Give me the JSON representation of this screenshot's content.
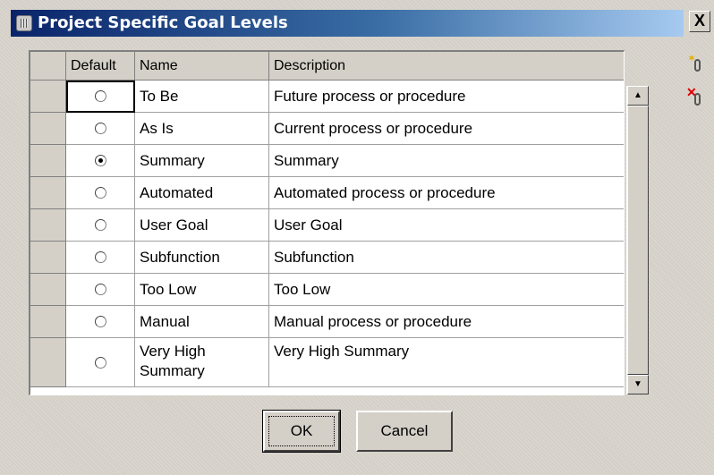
{
  "window": {
    "title": "Project Specific Goal Levels",
    "close_label": "X"
  },
  "toolbar": {
    "add_icon": "add-attachment-icon",
    "remove_icon": "remove-attachment-icon"
  },
  "table": {
    "columns": [
      "Default",
      "Name",
      "Description"
    ],
    "rows": [
      {
        "default": false,
        "name": "To Be",
        "description": "Future process or procedure"
      },
      {
        "default": false,
        "name": "As Is",
        "description": "Current process or procedure"
      },
      {
        "default": true,
        "name": "Summary",
        "description": "Summary"
      },
      {
        "default": false,
        "name": "Automated",
        "description": "Automated process or procedure"
      },
      {
        "default": false,
        "name": "User Goal",
        "description": "User Goal"
      },
      {
        "default": false,
        "name": "Subfunction",
        "description": "Subfunction"
      },
      {
        "default": false,
        "name": "Too Low",
        "description": "Too Low"
      },
      {
        "default": false,
        "name": "Manual",
        "description": "Manual process or procedure"
      },
      {
        "default": false,
        "name": "Very High Summary",
        "description": "Very High Summary"
      }
    ]
  },
  "buttons": {
    "ok_label": "OK",
    "cancel_label": "Cancel"
  },
  "colors": {
    "title_gradient_start": "#0a246a",
    "title_gradient_end": "#a6caf0",
    "dialog_bg": "#d4d0c8"
  }
}
